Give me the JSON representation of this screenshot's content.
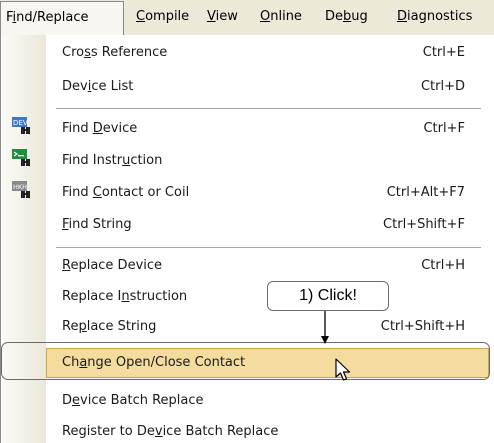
{
  "menubar": {
    "items": [
      {
        "pre": "F",
        "u": "i",
        "post": "nd/Replace"
      },
      {
        "pre": "",
        "u": "C",
        "post": "ompile"
      },
      {
        "pre": "",
        "u": "V",
        "post": "iew"
      },
      {
        "pre": "",
        "u": "O",
        "post": "nline"
      },
      {
        "pre": "De",
        "u": "b",
        "post": "ug"
      },
      {
        "pre": "",
        "u": "D",
        "post": "iagnostics"
      }
    ]
  },
  "menu": {
    "items": [
      {
        "pre": "Cro",
        "u": "s",
        "post": "s Reference",
        "shortcut": "Ctrl+E"
      },
      {
        "pre": "Dev",
        "u": "i",
        "post": "ce List",
        "shortcut": "Ctrl+D"
      },
      {
        "pre": "Find ",
        "u": "D",
        "post": "evice",
        "shortcut": "Ctrl+F",
        "icon": "find-device-icon"
      },
      {
        "pre": "Find Instr",
        "u": "u",
        "post": "ction",
        "shortcut": "",
        "icon": "find-instruction-icon"
      },
      {
        "pre": "Find ",
        "u": "C",
        "post": "ontact or Coil",
        "shortcut": "Ctrl+Alt+F7",
        "icon": "find-contact-icon"
      },
      {
        "pre": "",
        "u": "F",
        "post": "ind String",
        "shortcut": "Ctrl+Shift+F"
      },
      {
        "pre": "",
        "u": "R",
        "post": "eplace Device",
        "shortcut": "Ctrl+H"
      },
      {
        "pre": "Replace I",
        "u": "n",
        "post": "struction",
        "shortcut": ""
      },
      {
        "pre": "Re",
        "u": "p",
        "post": "lace String",
        "shortcut": "Ctrl+Shift+H"
      },
      {
        "pre": "Ch",
        "u": "a",
        "post": "nge Open/Close Contact",
        "shortcut": ""
      },
      {
        "pre": "D",
        "u": "e",
        "post": "vice Batch Replace",
        "shortcut": ""
      },
      {
        "pre": "Register to De",
        "u": "v",
        "post": "ice Batch Replace",
        "shortcut": ""
      }
    ]
  },
  "callout": {
    "text": "1) Click!"
  },
  "icons": {
    "find-device": "DEV",
    "find-contact": "HKH"
  },
  "colors": {
    "highlight": "#f3dc9e",
    "menubar": "#ece9d8"
  }
}
